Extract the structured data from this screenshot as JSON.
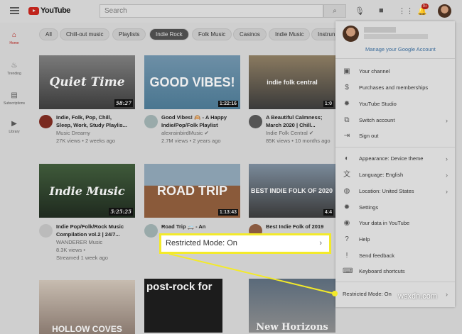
{
  "header": {
    "logo": "YouTube",
    "search_placeholder": "Search",
    "notification_badge": "9+"
  },
  "sidebar": [
    {
      "label": "Home",
      "icon": "home-icon"
    },
    {
      "label": "Trending",
      "icon": "flame-icon"
    },
    {
      "label": "Subscriptions",
      "icon": "subscriptions-icon"
    },
    {
      "label": "Library",
      "icon": "library-icon"
    }
  ],
  "chips": [
    "All",
    "Chill-out music",
    "Playlists",
    "Indie Rock",
    "Folk Music",
    "Casinos",
    "Indie Music",
    "Instrun"
  ],
  "videos": [
    {
      "thumb": "Quiet Time",
      "duration": "58:27",
      "title1": "Indie, Folk, Pop, Chill,",
      "title2": "Sleep, Work, Study Playlis...",
      "channel": "Music Dreamy",
      "stats": "27K views • 2 weeks ago"
    },
    {
      "thumb": "GOOD VIBES!",
      "duration": "1:22:16",
      "title1": "Good Vibes! 🙉 - A Happy",
      "title2": "Indie/Pop/Folk Playlist",
      "channel": "alexrainbirdMusic ✔",
      "stats": "2.7M views • 2 years ago"
    },
    {
      "thumb": "indie folk central",
      "duration": "1:0",
      "title1": "A Beautiful Calmness;",
      "title2": "March 2020 | Chill...",
      "channel": "Indie Folk Central ✔",
      "stats": "85K views • 10 months ago"
    },
    {
      "thumb": "Indie Music",
      "duration": "5:25:25",
      "title1": "Indie Pop/Folk/Rock Music",
      "title2": "Compilation vol.2 | 24/7...",
      "channel": "WANDERER Music",
      "stats": "8.3K views •",
      "stats2": "Streamed 1 week ago"
    },
    {
      "thumb": "ROAD TRIP",
      "duration": "1:13:43",
      "title1": "Road Trip 🚐 - An",
      "title2": "",
      "channel": "",
      "stats": ""
    },
    {
      "thumb": "BEST INDIE FOLK OF 2020",
      "duration": "4:4",
      "title1": "Best Indie Folk of 2019",
      "title2": "",
      "channel": "",
      "stats": ""
    },
    {
      "thumb": "HOLLOW COVES"
    },
    {
      "thumb": "post-rock for"
    },
    {
      "thumb": "New Horizons"
    }
  ],
  "account_menu": {
    "manage": "Manage your Google Account",
    "items": [
      {
        "label": "Your channel",
        "icon": "▣"
      },
      {
        "label": "Purchases and memberships",
        "icon": "$"
      },
      {
        "label": "YouTube Studio",
        "icon": "✹"
      },
      {
        "label": "Switch account",
        "icon": "⧉",
        "chevron": "›"
      },
      {
        "label": "Sign out",
        "icon": "⇥"
      },
      {
        "label": "Appearance: Device theme",
        "icon": "◐",
        "chevron": "›"
      },
      {
        "label": "Language: English",
        "icon": "文",
        "chevron": "›"
      },
      {
        "label": "Location: United States",
        "icon": "◍",
        "chevron": "›"
      },
      {
        "label": "Settings",
        "icon": "✹"
      },
      {
        "label": "Your data in YouTube",
        "icon": "◉"
      },
      {
        "label": "Help",
        "icon": "?"
      },
      {
        "label": "Send feedback",
        "icon": "!"
      },
      {
        "label": "Keyboard shortcuts",
        "icon": "⌨"
      },
      {
        "label": "Restricted Mode: On",
        "icon": "",
        "chevron": "›"
      }
    ]
  },
  "callout": {
    "label": "Restricted Mode: On",
    "chevron": "›"
  },
  "watermark": "wsxdn.com",
  "colors": {
    "highlight": "#f3ea2a",
    "brand": "#c0241c"
  }
}
